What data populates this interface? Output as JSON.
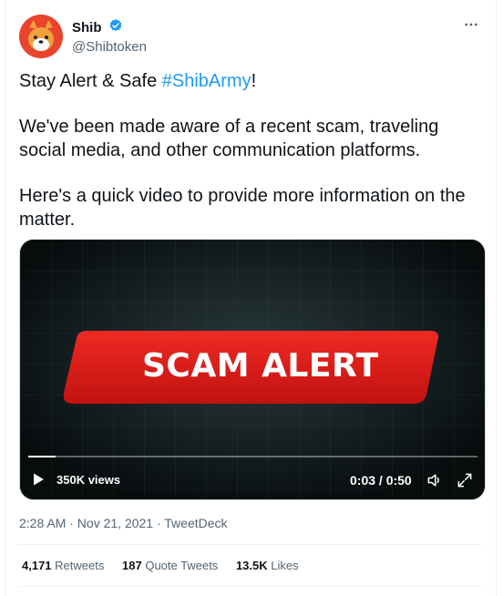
{
  "author": {
    "display_name": "Shib",
    "handle": "@Shibtoken",
    "verified": true,
    "avatar_icon": "shiba-inu-avatar-icon"
  },
  "tweet": {
    "line1_text": "Stay Alert & Safe ",
    "line1_hashtag": "#ShibArmy",
    "line1_suffix": "!",
    "paragraph2": "We've been made aware of a recent scam, traveling social media, and other communication platforms.",
    "paragraph3": "Here's a quick video to provide more information on the matter."
  },
  "video": {
    "banner_text": "SCAM ALERT",
    "views": "350K views",
    "time": "0:03 / 0:50",
    "progress": 0.06,
    "banner_color": "#e0201b"
  },
  "meta": {
    "timestamp": "2:28 AM · Nov 21, 2021 · TweetDeck"
  },
  "stats": [
    {
      "count": "4,171",
      "label": "Retweets"
    },
    {
      "count": "187",
      "label": "Quote Tweets"
    },
    {
      "count": "13.5K",
      "label": "Likes"
    }
  ],
  "colors": {
    "accent": "#1d9bf0",
    "text": "#0f1419",
    "secondary": "#536471"
  }
}
